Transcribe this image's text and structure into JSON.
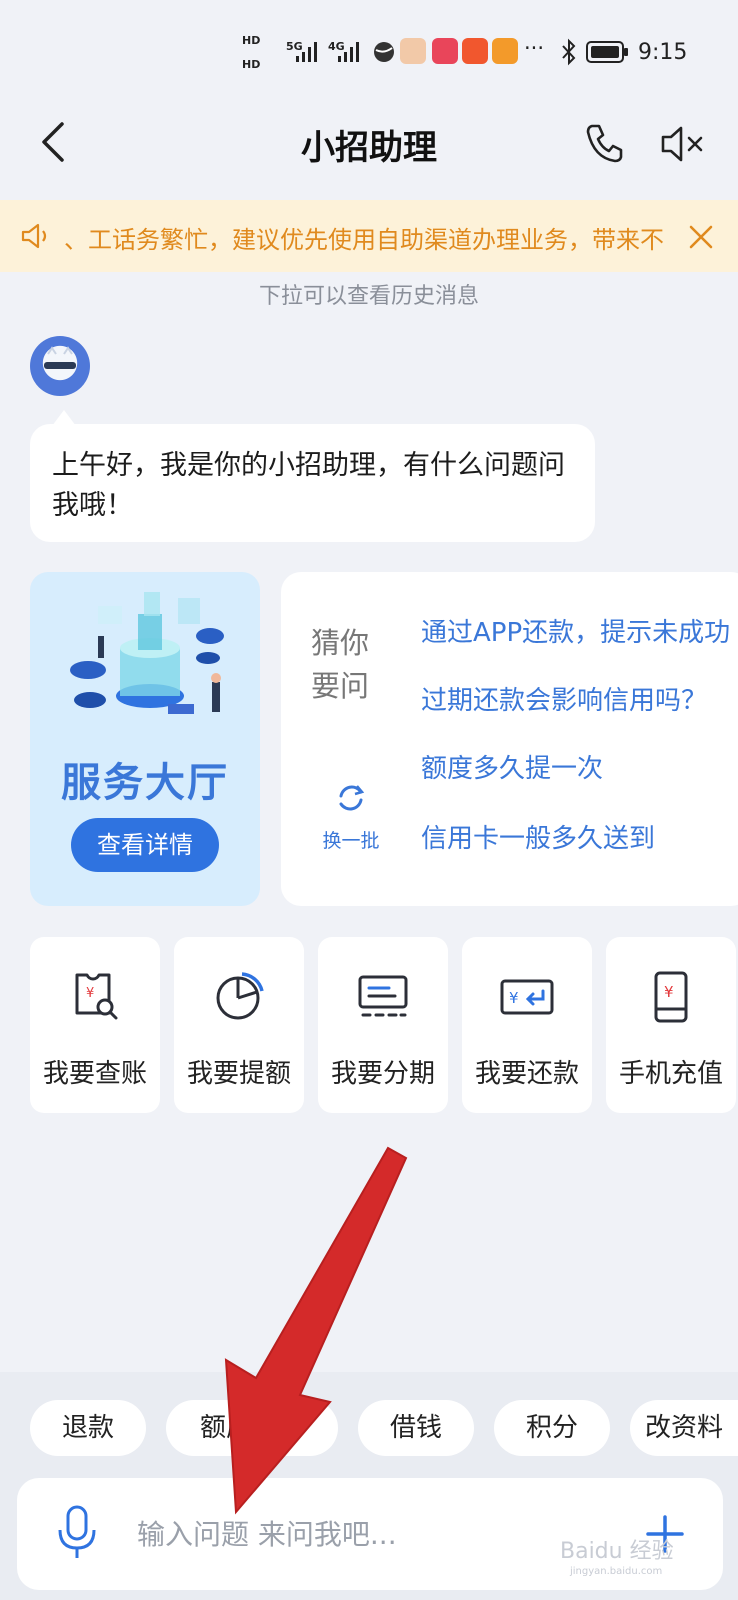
{
  "status_bar": {
    "hd1": "HD",
    "hd2": "HD",
    "net1": "5G",
    "net2": "4G",
    "more": "···",
    "time": "9:15"
  },
  "header": {
    "title": "小招助理"
  },
  "notice": {
    "text": "、工话务繁忙，建议优先使用自助渠道办理业务，带来不便"
  },
  "history_hint": "下拉可以查看历史消息",
  "greeting": {
    "text": "上午好，我是你的小招助理，有什么问题问我哦！"
  },
  "service_hall": {
    "title": "服务大厅",
    "button": "查看详情"
  },
  "guess": {
    "label": "猜你要问",
    "refresh": "换一批",
    "questions": [
      "通过APP还款，提示未成功",
      "过期还款会影响信用吗？",
      "额度多久提一次",
      "信用卡一般多久送到"
    ]
  },
  "quick_actions": [
    {
      "label": "我要查账",
      "icon": "bill-search-icon"
    },
    {
      "label": "我要提额",
      "icon": "pie-chart-icon"
    },
    {
      "label": "我要分期",
      "icon": "installment-icon"
    },
    {
      "label": "我要还款",
      "icon": "repay-card-icon"
    },
    {
      "label": "手机充值",
      "icon": "phone-recharge-icon"
    }
  ],
  "chips": [
    "退款",
    "额度查询",
    "借钱",
    "积分",
    "改资料"
  ],
  "input": {
    "placeholder": "输入问题 来问我吧..."
  },
  "watermark": {
    "main": "Baidu 经验",
    "sub": "jingyan.baidu.com"
  },
  "colors": {
    "accent": "#3a77d8",
    "button": "#2f73e0",
    "notice_bg": "#fdf2d9",
    "notice_text": "#e08a1e",
    "background": "#f0f2f7",
    "arrow": "#d42a2a"
  }
}
